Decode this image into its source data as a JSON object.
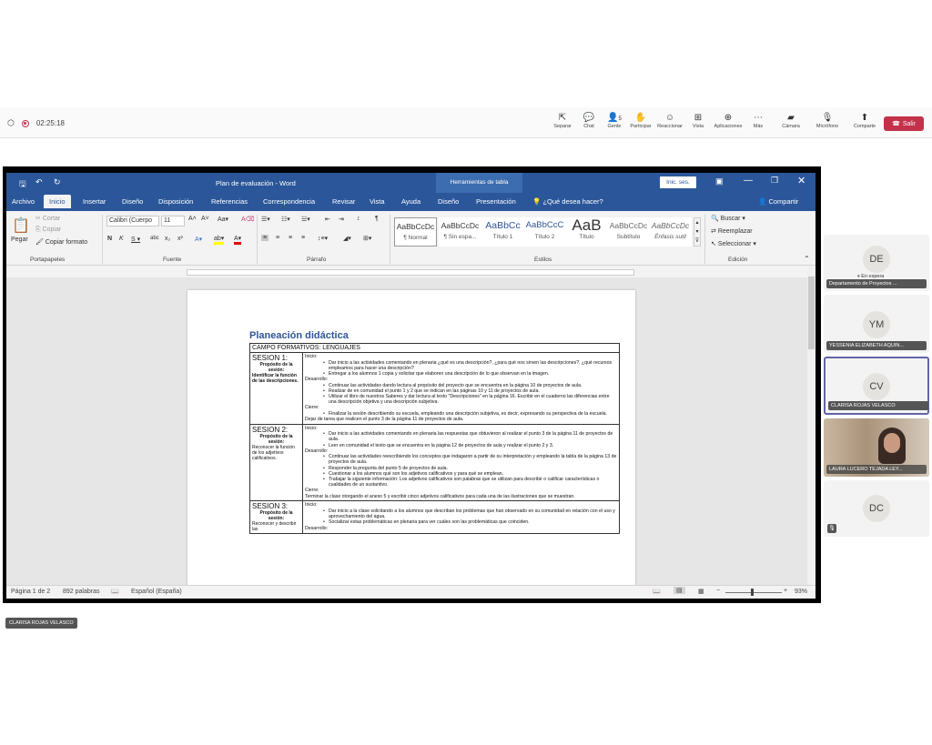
{
  "meeting": {
    "timer": "02:25:18",
    "toolbar": [
      {
        "icon": "share-icon",
        "label": "Separar"
      },
      {
        "icon": "chat-icon",
        "label": "Chat"
      },
      {
        "icon": "people-icon",
        "label": "Gente",
        "count": "5"
      },
      {
        "icon": "raise-hand-icon",
        "label": "Participar"
      },
      {
        "icon": "emoji-icon",
        "label": "Reaccionar"
      },
      {
        "icon": "view-icon",
        "label": "Vista"
      },
      {
        "icon": "apps-icon",
        "label": "Aplicaciones"
      },
      {
        "icon": "more-icon",
        "label": "Más"
      },
      {
        "icon": "camera-off-icon",
        "label": "Cámara"
      },
      {
        "icon": "mic-off-icon",
        "label": "Micrófono"
      },
      {
        "icon": "share-screen-icon",
        "label": "Comparte"
      }
    ],
    "leave_label": "Salir",
    "self_label": "CLARISA ROJAS VELASCO"
  },
  "participants": [
    {
      "initials": "DE",
      "status": "En espera",
      "name": "Departamento de Proyectos ..."
    },
    {
      "initials": "YM",
      "name": "YESSENIA ELIZABETH AQUIN..."
    },
    {
      "initials": "CV",
      "name": "CLARISA ROJAS VELASCO"
    },
    {
      "initials": "",
      "name": "LAURA LUCERO TEJADA LEY..."
    },
    {
      "initials": "DC",
      "name": ""
    }
  ],
  "word": {
    "title": "Plan de evaluación - Word",
    "context_tab": "Herramientas de tabla",
    "sign_in": "Inic. ses.",
    "tabs": [
      "Archivo",
      "Inicio",
      "Insertar",
      "Diseño",
      "Disposición",
      "Referencias",
      "Correspondencia",
      "Revisar",
      "Vista",
      "Ayuda",
      "Diseño",
      "Presentación"
    ],
    "tell_me": "¿Qué desea hacer?",
    "share": "Compartir",
    "clipboard": {
      "paste": "Pegar",
      "cut": "Cortar",
      "copy": "Copiar",
      "format_painter": "Copiar formato",
      "label": "Portapapeles"
    },
    "font": {
      "name": "Calibri (Cuerpo",
      "size": "11",
      "label": "Fuente"
    },
    "paragraph_label": "Párrafo",
    "styles": [
      {
        "preview": "AaBbCcDc",
        "label": "¶ Normal"
      },
      {
        "preview": "AaBbCcDc",
        "label": "¶ Sin espa..."
      },
      {
        "preview": "AaBbCc",
        "label": "Título 1"
      },
      {
        "preview": "AaBbCcC",
        "label": "Título 2"
      },
      {
        "preview": "AaB",
        "label": "Título"
      },
      {
        "preview": "AaBbCcDc",
        "label": "Subtítulo"
      },
      {
        "preview": "AaBbCcDc",
        "label": "Énfasis sutil"
      }
    ],
    "styles_label": "Estilos",
    "editing": {
      "find": "Buscar",
      "replace": "Reemplazar",
      "select": "Seleccionar",
      "label": "Edición"
    },
    "status": {
      "page": "Página 1 de 2",
      "words": "892 palabras",
      "language": "Español (España)",
      "zoom": "93%"
    }
  },
  "document": {
    "title": "Planeación didáctica",
    "campo": "CAMPO FORMATIVOS: LENGUAJES",
    "sessions": [
      {
        "name": "SESION 1:",
        "purpose_label": "Propósito de la sesión:",
        "purpose": "Identificar la función de las descripciones.",
        "inicio": "Inicio:",
        "inicio_items": [
          "Dar inicio a las actividades comentando en plenaria ¿qué es una descripción?, ¿para qué nos sirven las descripciones?, ¿qué recursos empleamos para hacer una descripción?",
          "Entregar a los alumnos 1 copia y solicitar que elaboren una descripción de lo que observan en la imagen."
        ],
        "desarrollo": "Desarrollo:",
        "desarrollo_items": [
          "Continuar las actividades dando lectura al propósito del proyecto que se encuentra en la página 10 de proyectos de aula.",
          "Realizar de en comunidad el punto 1 y 2 que se indican en las páginas 10 y 11 de proyectos de aula.",
          "Utilizar el libro de nuestros Saberes y dar lectura al texto \"Descripciones\" en la página 16. Escribir en el cuaderno las diferencias entre una descripción objetiva y una descripción subjetiva."
        ],
        "cierre": "Cierre:",
        "cierre_items": [
          "Finalizar la sesión describiendo su escuela, empleando una descripción subjetiva, es decir, expresando su perspectiva de la escuela."
        ],
        "tarea": "Dejar de tarea que realicen el punto 3 de la página 11 de proyectos de aula."
      },
      {
        "name": "SESION 2:",
        "purpose_label": "Propósito de la sesión:",
        "purpose": "Reconocer la función de los adjetivos calificativos.",
        "inicio": "Inicio:",
        "inicio_items": [
          "Dar inicio a las actividades comentando en plenaria las respuestas que obtuvieron al realizar el punto 3 de la página 11 de proyectos de aula.",
          "Leer en comunidad el texto que se encuentra en la página 12 de proyectos de aula y realizar el punto 2 y 3."
        ],
        "desarrollo": "Desarrollo:",
        "desarrollo_items": [
          "Continuar las actividades reescribiendo los conceptos que indagaron a partir de su interpretación y empleando la tabla de la página 13 de proyectos de aula.",
          "Responder la pregunta del punto 5 de proyectos de aula.",
          "Cuestionar a los alumnos qué son los adjetivos calificativos y para qué se emplean.",
          "Trabajar la siguiente información: Los adjetivos calificativos son palabras que se utilizan para describir o calificar características o cualidades de un sustantivo."
        ],
        "cierre": "Cierre:",
        "tarea": "Terminar la clase otorgando el anexo 5 y escribir cinco adjetivos calificativos para cada una de las ilustraciones que se muestran."
      },
      {
        "name": "SESION 3:",
        "purpose_label": "Propósito de la sesión:",
        "purpose": "Reconocer y describir las",
        "inicio": "Inicio:",
        "inicio_items": [
          "Dar inicio a la clase solicitando a los alumnos que describan los problemas que han observado en su comunidad en relación con el uso y aprovechamiento del agua.",
          "Socializar estas problemáticas en plenaria para ver cuáles son las problemáticas que coinciden."
        ],
        "desarrollo": "Desarrollo:"
      }
    ]
  }
}
